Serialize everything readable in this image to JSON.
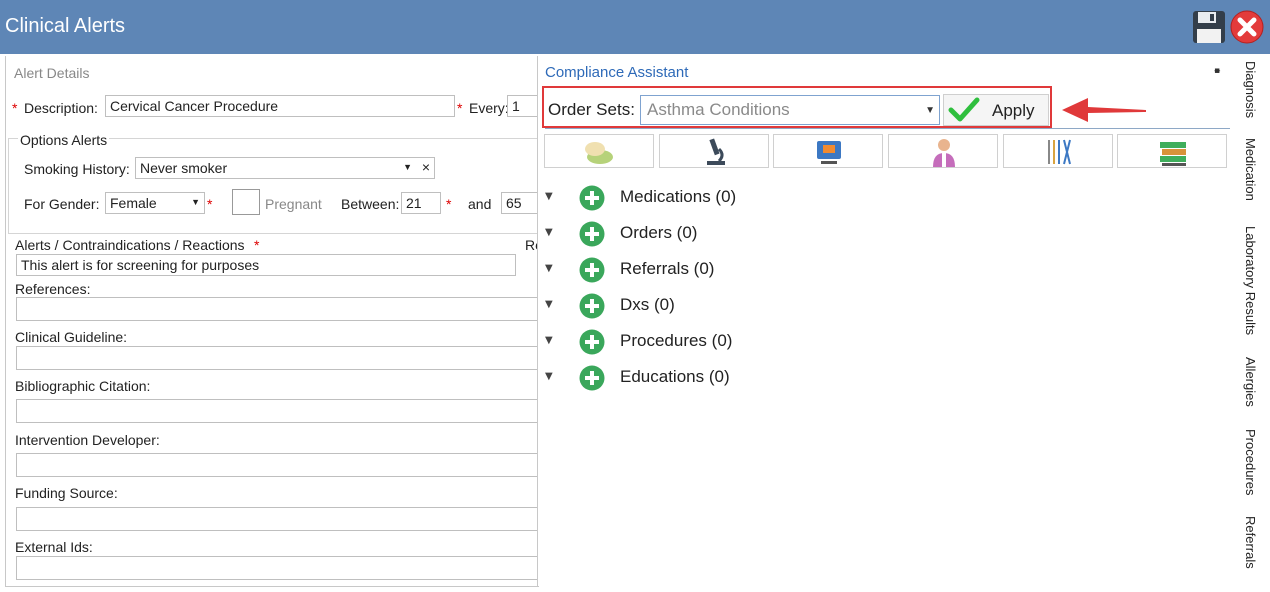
{
  "window": {
    "title": "Clinical Alerts"
  },
  "alert_details": {
    "section_title": "Alert Details",
    "description_label": "Description:",
    "description_value": "Cervical Cancer Procedure",
    "every_label": "Every:",
    "every_value": "1",
    "options_title": "Options Alerts",
    "smoking_label": "Smoking History:",
    "smoking_value": "Never smoker",
    "gender_label": "For Gender:",
    "gender_value": "Female",
    "pregnant_label": "Pregnant",
    "between_label": "Between:",
    "between_value": "21",
    "and_label": "and",
    "and_value": "65",
    "alerts_label": "Alerts / Contraindications / Reactions",
    "alerts_value": "This alert is for screening for purposes",
    "re_cut_label": "Re",
    "references_label": "References:",
    "guideline_label": "Clinical Guideline:",
    "citation_label": "Bibliographic Citation:",
    "developer_label": "Intervention Developer:",
    "funding_label": "Funding Source:",
    "external_label": "External Ids:",
    "required_mark": "*",
    "clear_mark": "×"
  },
  "compliance": {
    "title": "Compliance Assistant",
    "order_sets_label": "Order Sets:",
    "order_sets_value": "Asthma Conditions",
    "apply_label": "Apply",
    "toolbar_icons": [
      "pills-icon",
      "microscope-icon",
      "monitor-icon",
      "doctor-icon",
      "instruments-icon",
      "books-icon"
    ],
    "categories": [
      {
        "label": "Medications (0)"
      },
      {
        "label": "Orders (0)"
      },
      {
        "label": "Referrals (0)"
      },
      {
        "label": "Dxs (0)"
      },
      {
        "label": "Procedures (0)"
      },
      {
        "label": "Educations (0)"
      }
    ]
  },
  "side_tabs": [
    "Diagnosis",
    "Medication",
    "Laboratory Results",
    "Allergies",
    "Procedures",
    "Referrals"
  ],
  "colors": {
    "titlebar": "#5e86b6",
    "accent_blue": "#2e6ab8",
    "highlight_red": "#e0393a",
    "plus_green": "#3aa75b"
  }
}
